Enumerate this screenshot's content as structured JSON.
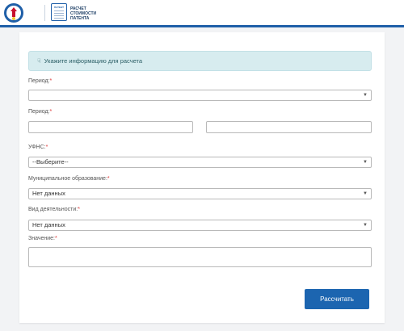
{
  "header": {
    "app_title_lines": [
      "РАСЧЕТ",
      "СТОИМОСТИ",
      "ПАТЕНТА"
    ],
    "patent_badge": "ПАТЕНТ"
  },
  "info": {
    "text": "Укажите информацию для расчета"
  },
  "form": {
    "period1": {
      "label": "Период:",
      "required": "*",
      "value": ""
    },
    "period2": {
      "label": "Период:",
      "required": "*",
      "from_value": "",
      "to_value": ""
    },
    "ufns": {
      "label": "УФНС:",
      "required": "*",
      "value": "--Выберите--"
    },
    "municipality": {
      "label": "Муниципальное образование:",
      "required": "*",
      "value": "Нет данных"
    },
    "activity": {
      "label": "Вид деятельности:",
      "required": "*",
      "value": "Нет данных"
    },
    "amount": {
      "label": "Значение:",
      "required": "*",
      "value": ""
    }
  },
  "submit": {
    "label": "Рассчитать"
  },
  "colors": {
    "accent": "#1c65b0",
    "banner_bg": "#d7ecef",
    "header_line": "#1f5fa8"
  },
  "icons": {
    "info": "hand-pointer-icon",
    "chevron": "chevron-down-icon"
  }
}
